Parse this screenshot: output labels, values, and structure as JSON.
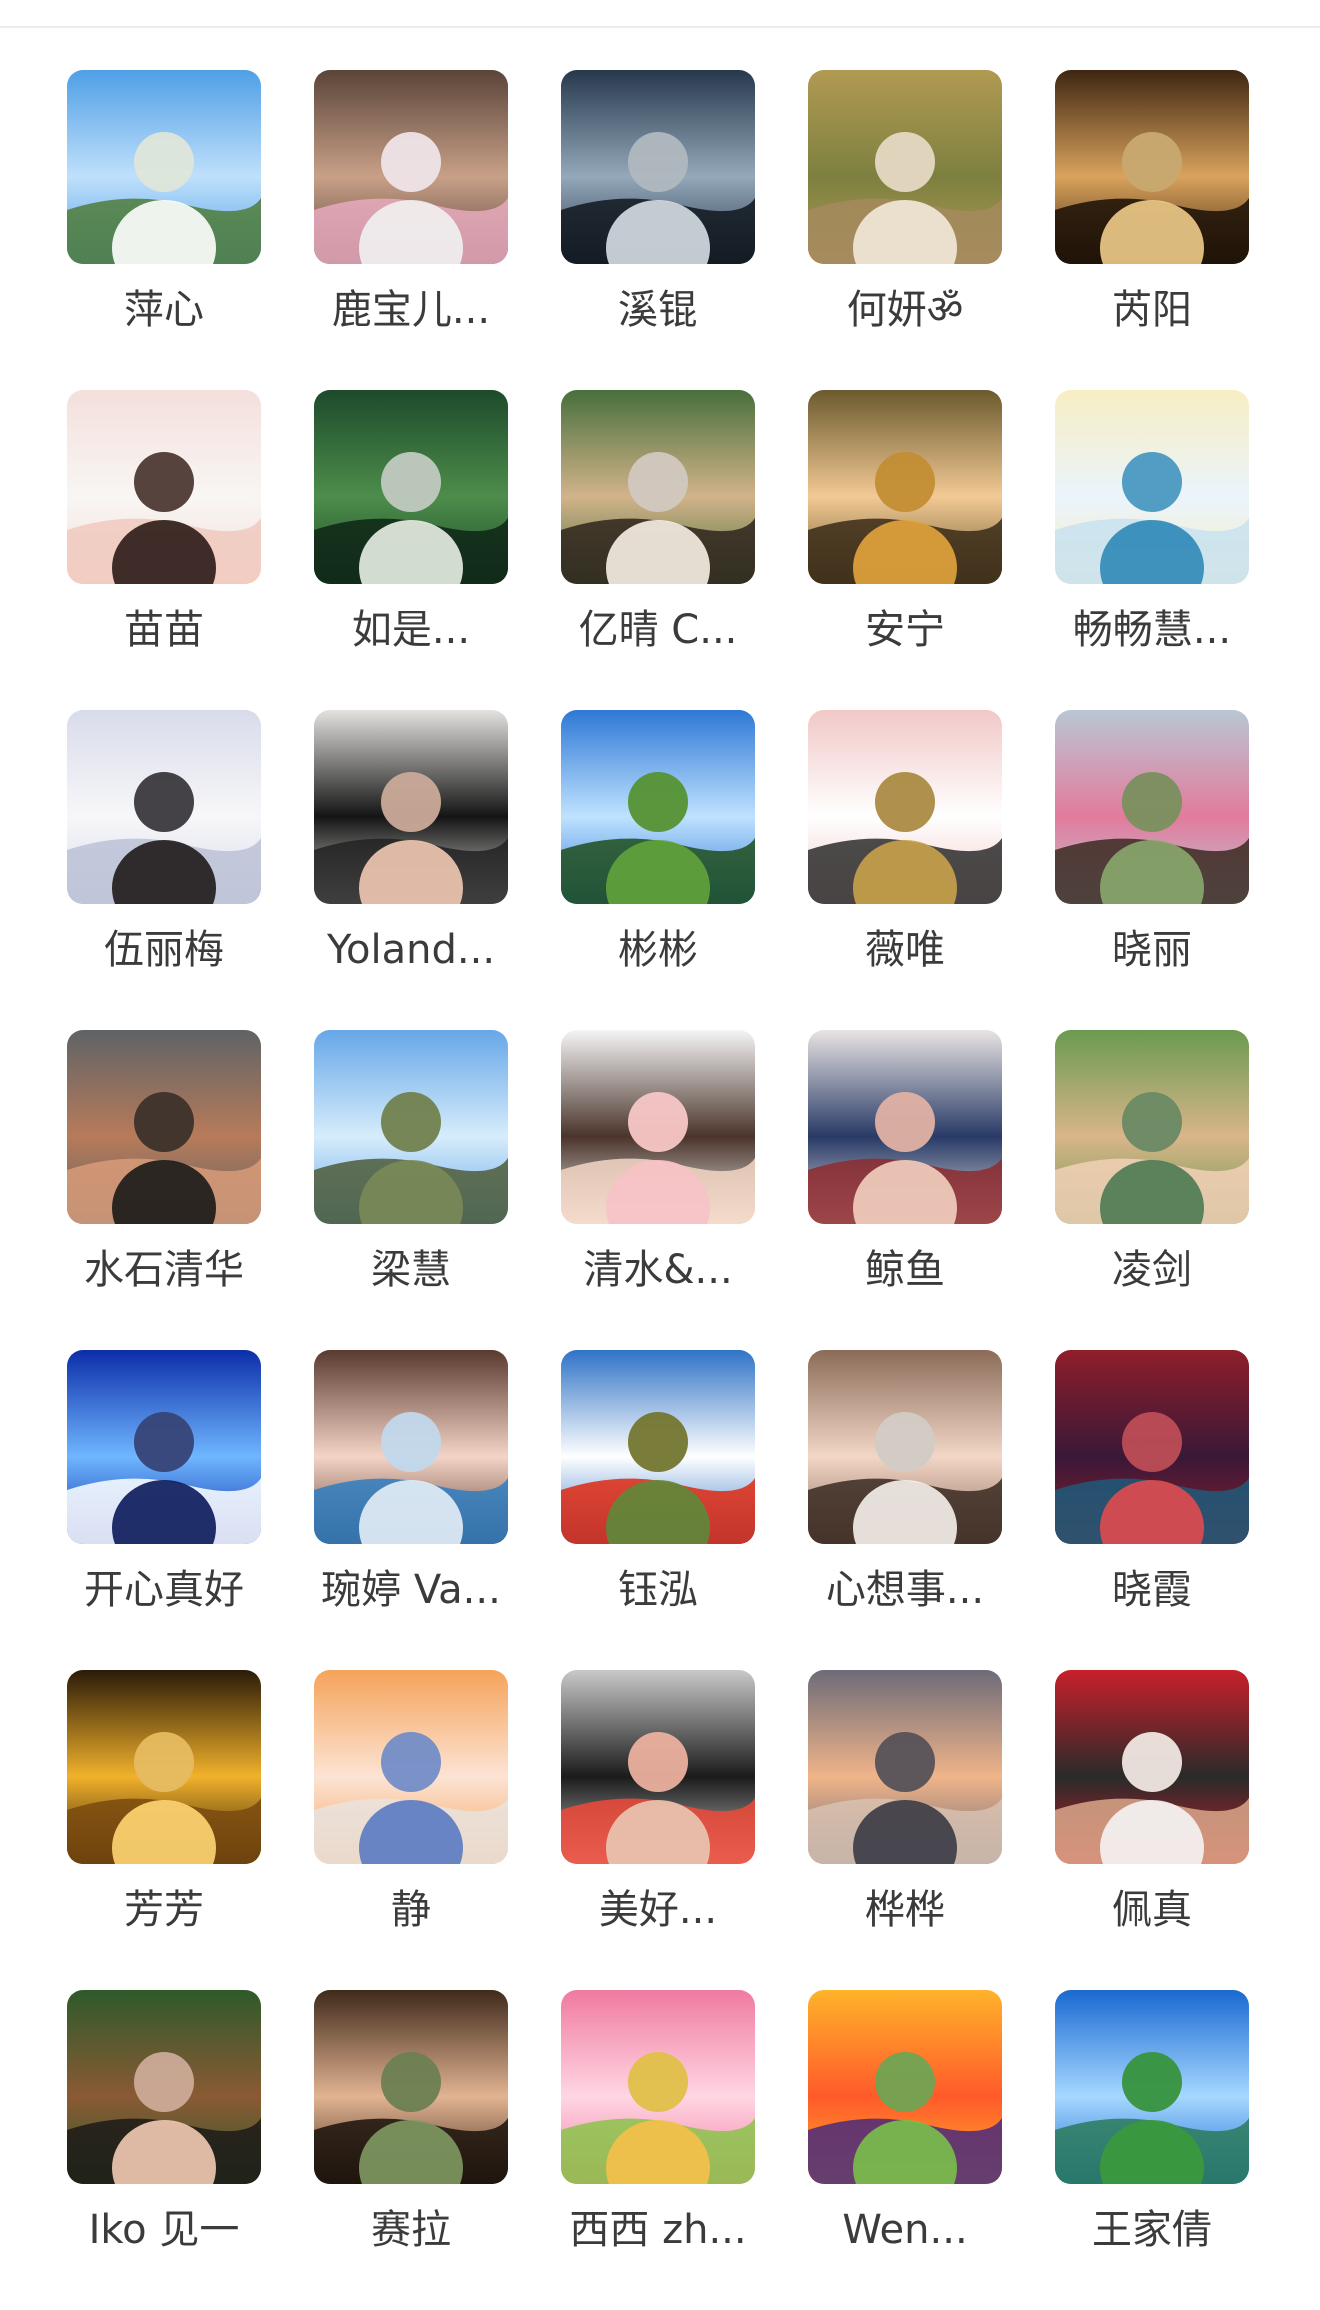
{
  "members": [
    {
      "name": "萍心",
      "avatar": "sky-clouds-trees",
      "colors": [
        "#4f9fe6",
        "#bfe0fb",
        "#ffffff",
        "#4f7b39"
      ]
    },
    {
      "name": "鹿宝儿...",
      "avatar": "woman-with-flowers-indoor",
      "colors": [
        "#5a4438",
        "#c8a088",
        "#f1f1f1",
        "#e6a9bd"
      ]
    },
    {
      "name": "溪锟",
      "avatar": "person-on-rocks-reflection",
      "colors": [
        "#27384c",
        "#94a8ba",
        "#d6dee5",
        "#10161d"
      ]
    },
    {
      "name": "何妍ॐ",
      "avatar": "woman-in-field-with-cap",
      "colors": [
        "#b19a52",
        "#7d8040",
        "#f3e9da",
        "#a58a5e"
      ]
    },
    {
      "name": "芮阳",
      "avatar": "tree-at-sunset",
      "colors": [
        "#3f2612",
        "#d9a35c",
        "#f0cc8a",
        "#1a0f06"
      ]
    },
    {
      "name": "苗苗",
      "avatar": "woman-portrait-white-coat",
      "colors": [
        "#f4dfdc",
        "#f8f6f3",
        "#2b1b17",
        "#f0c9bd"
      ]
    },
    {
      "name": "如是...",
      "avatar": "forest-poster",
      "colors": [
        "#1d4a2b",
        "#4d8d4b",
        "#e9efe6",
        "#0e2616"
      ]
    },
    {
      "name": "亿晴 C...",
      "avatar": "woman-straw-hat",
      "colors": [
        "#486f3c",
        "#d2b38a",
        "#f8efe6",
        "#2f241c"
      ]
    },
    {
      "name": "安宁",
      "avatar": "cartoon-girl-sunflowers",
      "colors": [
        "#6b5a2e",
        "#f2c994",
        "#e3a43c",
        "#3a2a18"
      ]
    },
    {
      "name": "畅畅慧...",
      "avatar": "temple-in-clouds",
      "colors": [
        "#f8eec4",
        "#eaf4fb",
        "#2d88b7",
        "#c8e2f0"
      ]
    },
    {
      "name": "伍丽梅",
      "avatar": "woman-white-suit-studio",
      "colors": [
        "#d8dbea",
        "#f7f7f9",
        "#1f1a1a",
        "#bcc1d6"
      ]
    },
    {
      "name": "Yoland...",
      "avatar": "woman-with-glasses",
      "colors": [
        "#e4e2df",
        "#141414",
        "#f1c9b4",
        "#222222"
      ]
    },
    {
      "name": "彬彬",
      "avatar": "park-lawn-blue-sky",
      "colors": [
        "#2e78d5",
        "#bfe2ff",
        "#63a33b",
        "#1f4e1c"
      ]
    },
    {
      "name": "薇唯",
      "avatar": "white-bunny-figurine",
      "colors": [
        "#f1c8c7",
        "#ffffff",
        "#c9a24a",
        "#2c2c2c"
      ]
    },
    {
      "name": "晓丽",
      "avatar": "woman-in-flower-garden",
      "colors": [
        "#b9c7d4",
        "#e27b9c",
        "#89a86d",
        "#3b2a22"
      ]
    },
    {
      "name": "水石清华",
      "avatar": "man-close-up-portrait",
      "colors": [
        "#5f6366",
        "#b77b5a",
        "#1a1a1a",
        "#d89b79"
      ]
    },
    {
      "name": "梁慧",
      "avatar": "safari-jeep",
      "colors": [
        "#66a7e8",
        "#d6ecfb",
        "#7a8a56",
        "#4d5c38"
      ]
    },
    {
      "name": "清水&...",
      "avatar": "cartoon-girl-pigtails",
      "colors": [
        "#f5f5f5",
        "#4a342b",
        "#f7c2c6",
        "#f3d6c4"
      ]
    },
    {
      "name": "鲸鱼",
      "avatar": "cartoon-girl-blue-hat",
      "colors": [
        "#e9e4e4",
        "#283a66",
        "#f2d0c0",
        "#8e2a2e"
      ]
    },
    {
      "name": "凌剑",
      "avatar": "man-with-sun-hat",
      "colors": [
        "#6a9a50",
        "#d9b58a",
        "#4c7a52",
        "#f2d0b7"
      ]
    },
    {
      "name": "开心真好",
      "avatar": "blue-fractal-pattern",
      "colors": [
        "#0b2da8",
        "#6fb6ff",
        "#0a1a5a",
        "#ffffff"
      ]
    },
    {
      "name": "琬婷 Va...",
      "avatar": "woman-selfie-colorful",
      "colors": [
        "#5a3a2f",
        "#f3d4c6",
        "#e5eef7",
        "#2e7cbf"
      ]
    },
    {
      "name": "钰泓",
      "avatar": "white-flower-china-flag",
      "colors": [
        "#2f73c7",
        "#ffffff",
        "#5d8a3a",
        "#de2910"
      ]
    },
    {
      "name": "心想事...",
      "avatar": "woman-smiling-indoor",
      "colors": [
        "#8b6b58",
        "#f2d6c6",
        "#f6f1ec",
        "#3a2a22"
      ]
    },
    {
      "name": "晓霞",
      "avatar": "dancer-silhouette-red",
      "colors": [
        "#8f1e2a",
        "#3a1838",
        "#e04a4e",
        "#1e5a7a"
      ]
    },
    {
      "name": "芳芳",
      "avatar": "golden-dress-woman",
      "colors": [
        "#2a1a08",
        "#f1b12b",
        "#ffd673",
        "#7a4a0f"
      ]
    },
    {
      "name": "静",
      "avatar": "anime-girl-orange-hair",
      "colors": [
        "#f5a35a",
        "#fce3d4",
        "#5a7ac2",
        "#e9e3de"
      ]
    },
    {
      "name": "美好...",
      "avatar": "woman-black-top-grey-bg",
      "colors": [
        "#c9c9c9",
        "#1b1b1b",
        "#e9c7b4",
        "#f04a38"
      ]
    },
    {
      "name": "桦桦",
      "avatar": "beach-sunset-person",
      "colors": [
        "#6d6b78",
        "#f0b489",
        "#3a3a44",
        "#d7c1b2"
      ]
    },
    {
      "name": "佩真",
      "avatar": "red-wall-woman",
      "colors": [
        "#c8202a",
        "#2a2a2a",
        "#f4f4f4",
        "#d9a78a"
      ]
    },
    {
      "name": "Iko 见一",
      "avatar": "woman-hat-outdoors",
      "colors": [
        "#2e5a2a",
        "#8a5a34",
        "#f3cbb5",
        "#1c1a18"
      ]
    },
    {
      "name": "赛拉",
      "avatar": "girl-dark-forest",
      "colors": [
        "#3f2a1a",
        "#e2b392",
        "#7f9a63",
        "#1a120c"
      ]
    },
    {
      "name": "西西 zh...",
      "avatar": "lotus-buddha",
      "colors": [
        "#f07aa0",
        "#ffd6e3",
        "#f6c04a",
        "#8bc34a"
      ]
    },
    {
      "name": "Wen...",
      "avatar": "golden-sunset-meadow",
      "colors": [
        "#ffb32a",
        "#ff5a2a",
        "#7ac04a",
        "#4b2a7a"
      ]
    },
    {
      "name": "王家倩",
      "avatar": "green-hills-lake",
      "colors": [
        "#1a69d1",
        "#a6d8ff",
        "#3a9a3a",
        "#2a7a5a"
      ]
    }
  ]
}
